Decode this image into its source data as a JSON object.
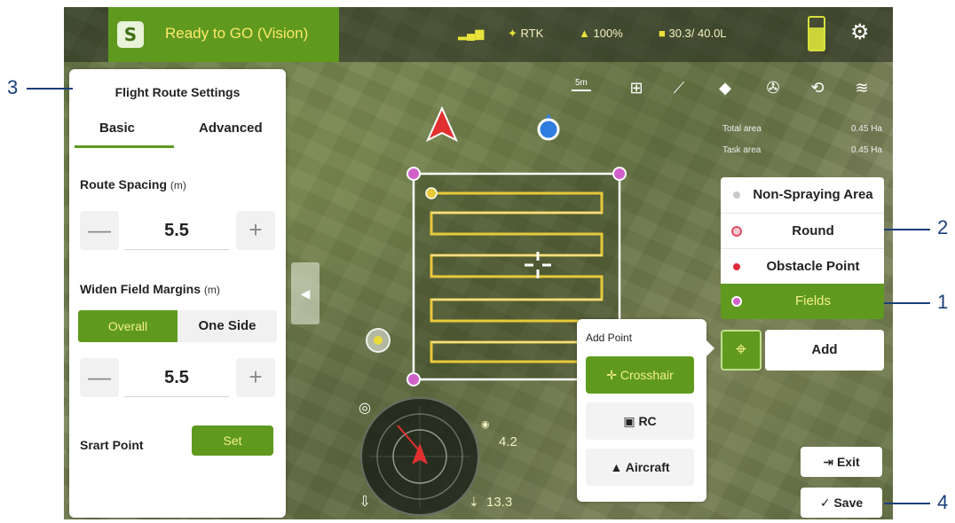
{
  "status_bar": {
    "status_text": "Ready to GO (Vision)",
    "signal_label": "RTK",
    "battery_level_text": "100%",
    "spray_text": "30.3/ 40.0L"
  },
  "map_tools": [
    "scale-ruler",
    "add-field",
    "measure",
    "eraser",
    "drone-settings",
    "rotate",
    "layers"
  ],
  "map_info": [
    {
      "label": "Total area",
      "value": "0.45 Ha"
    },
    {
      "label": "Task area",
      "value": "0.45 Ha"
    }
  ],
  "left_panel": {
    "title": "Flight Route Settings",
    "tabs": [
      "Basic",
      "Advanced"
    ],
    "route_spacing_label": "Route Spacing",
    "route_spacing_unit": "(m)",
    "route_spacing_value": "5.5",
    "widen_label": "Widen Field Margins",
    "widen_unit": "(m)",
    "widen_options": [
      "Overall",
      "One Side"
    ],
    "widen_value": "5.5",
    "start_point_label": "Srart Point",
    "set_label": "Set",
    "minus": "—",
    "plus": "+"
  },
  "right_menu": {
    "items": [
      {
        "label": "Non-Spraying Area",
        "dot": "#c8c8c8"
      },
      {
        "label": "Round",
        "dot": "#e0506a"
      },
      {
        "label": "Obstacle Point",
        "dot": "#e02a3a"
      },
      {
        "label": "Fields",
        "dot": "#d060c8"
      }
    ],
    "add_label": "Add"
  },
  "add_point": {
    "title": "Add Point",
    "options": [
      "Crosshair",
      "RC",
      "Aircraft"
    ]
  },
  "telemetry": {
    "d_value": "4.2",
    "h_value": "13.3"
  },
  "actions": {
    "exit_label": "Exit",
    "save_label": "Save"
  },
  "callouts": [
    "1",
    "2",
    "3",
    "4"
  ],
  "colors": {
    "accent": "#5f9a1f",
    "route": "#e8c93a",
    "field_corner": "#d060c8",
    "callout": "#1a3f7a"
  }
}
